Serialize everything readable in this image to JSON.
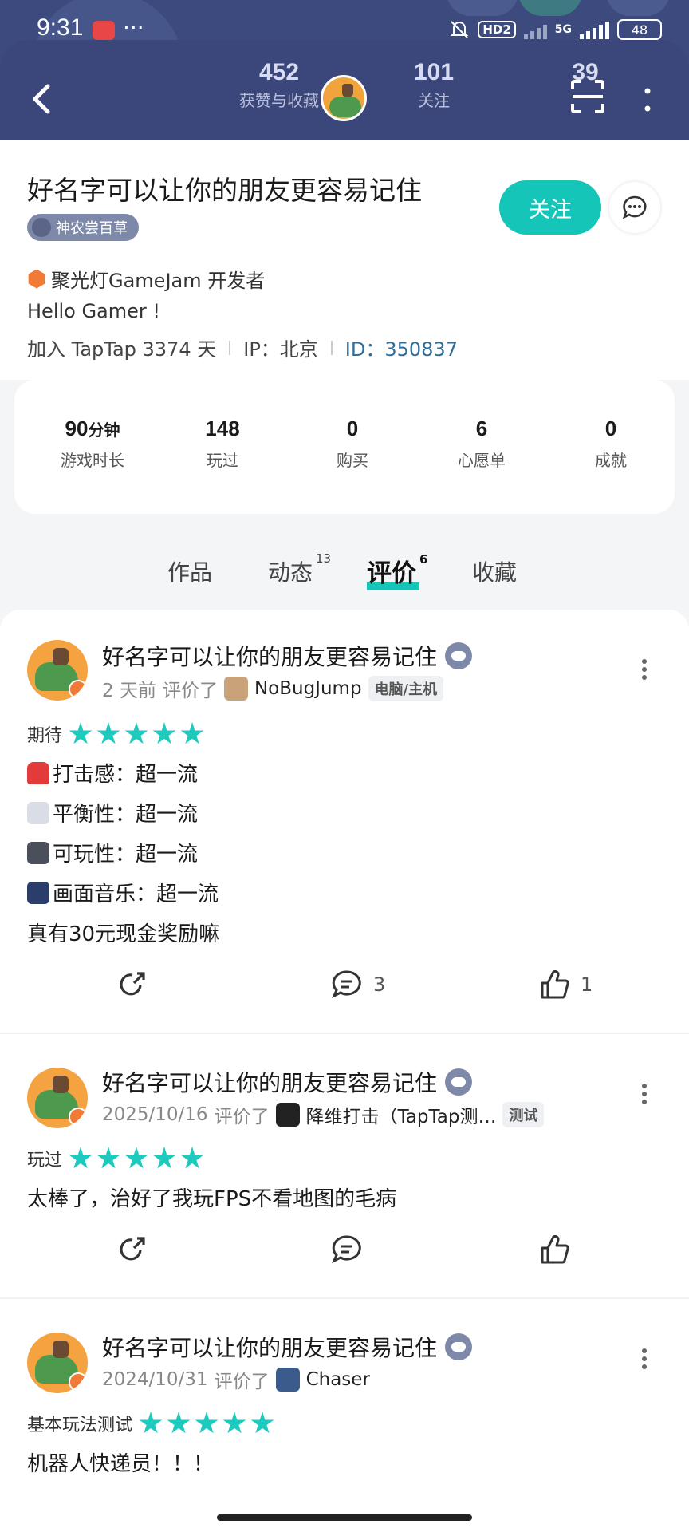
{
  "status_bar": {
    "time": "9:31",
    "dots": "···",
    "network": "5G",
    "hd": "HD2",
    "battery": "48"
  },
  "header": {
    "stats": [
      {
        "num": "452",
        "label": "获赞与收藏"
      },
      {
        "num": "101",
        "label": "关注"
      },
      {
        "num": "39",
        "label": ""
      }
    ]
  },
  "profile": {
    "name": "好名字可以让你的朋友更容易记住",
    "badge": "神农尝百草",
    "follow_label": "关注",
    "spotlight": "聚光灯GameJam 开发者",
    "bio": "Hello Gamer !",
    "joined": "加入 TapTap 3374 天",
    "ip": "IP：北京",
    "id": "ID：350837"
  },
  "stats": [
    {
      "num": "90",
      "unit": "分钟",
      "label": "游戏时长"
    },
    {
      "num": "148",
      "unit": "",
      "label": "玩过"
    },
    {
      "num": "0",
      "unit": "",
      "label": "购买"
    },
    {
      "num": "6",
      "unit": "",
      "label": "心愿单"
    },
    {
      "num": "0",
      "unit": "",
      "label": "成就"
    }
  ],
  "tabs": [
    {
      "label": "作品",
      "count": ""
    },
    {
      "label": "动态",
      "count": "13"
    },
    {
      "label": "评价",
      "count": "6"
    },
    {
      "label": "收藏",
      "count": ""
    }
  ],
  "reviews": [
    {
      "author": "好名字可以让你的朋友更容易记住",
      "date": "2 天前",
      "verb": "评价了",
      "game": "NoBugJump",
      "tag": "电脑/主机",
      "rating_label": "期待",
      "stars": 5,
      "lines": [
        "打击感：超一流",
        "平衡性：超一流",
        "可玩性：超一流",
        "画面音乐：超一流",
        "真有30元现金奖励嘛"
      ],
      "comments": "3",
      "likes": "1"
    },
    {
      "author": "好名字可以让你的朋友更容易记住",
      "date": "2025/10/16",
      "verb": "评价了",
      "game": "降维打击（TapTap测…",
      "tag": "测试",
      "rating_label": "玩过",
      "stars": 5,
      "lines": [
        "太棒了，治好了我玩FPS不看地图的毛病"
      ],
      "comments": "",
      "likes": ""
    },
    {
      "author": "好名字可以让你的朋友更容易记住",
      "date": "2024/10/31",
      "verb": "评价了",
      "game": "Chaser",
      "tag": "",
      "rating_label": "基本玩法测试",
      "stars": 5,
      "lines": [
        "机器人快递员！！！"
      ],
      "comments": "",
      "likes": ""
    }
  ],
  "colors": {
    "accent": "#15c6b8",
    "header_bg": "#3c4a7e",
    "star": "#1ec9bd",
    "id_link": "#2e6e9b"
  }
}
